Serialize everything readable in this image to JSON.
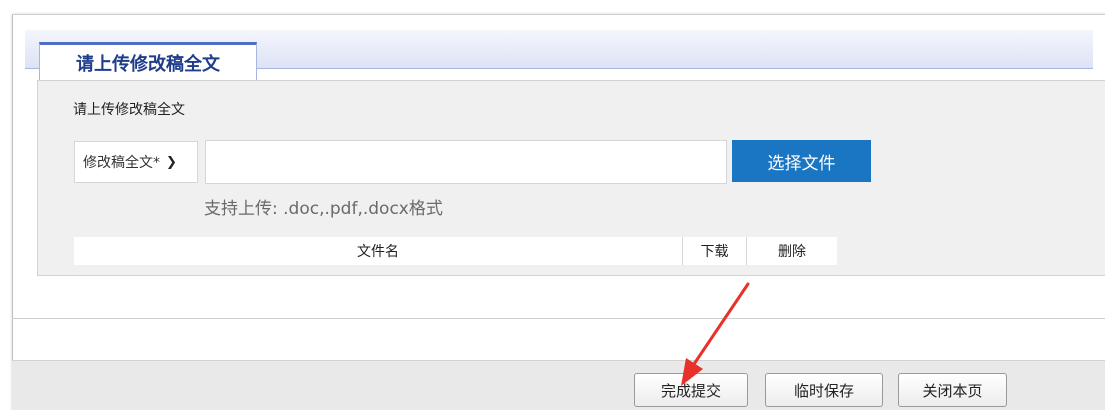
{
  "tab": {
    "label": "请上传修改稿全文"
  },
  "upload": {
    "title": "请上传修改稿全文",
    "file_type_selected": "修改稿全文*",
    "file_path_value": "",
    "choose_file_label": "选择文件",
    "supported_formats_hint": "支持上传: .doc,.pdf,.docx格式"
  },
  "file_table": {
    "columns": [
      "文件名",
      "下载",
      "删除"
    ],
    "rows": []
  },
  "footer": {
    "submit_label": "完成提交",
    "temp_save_label": "临时保存",
    "close_label": "关闭本页"
  },
  "colors": {
    "tab_text": "#1f3d8a",
    "primary_button": "#1a75c2",
    "annotation_arrow": "#e8312a"
  }
}
